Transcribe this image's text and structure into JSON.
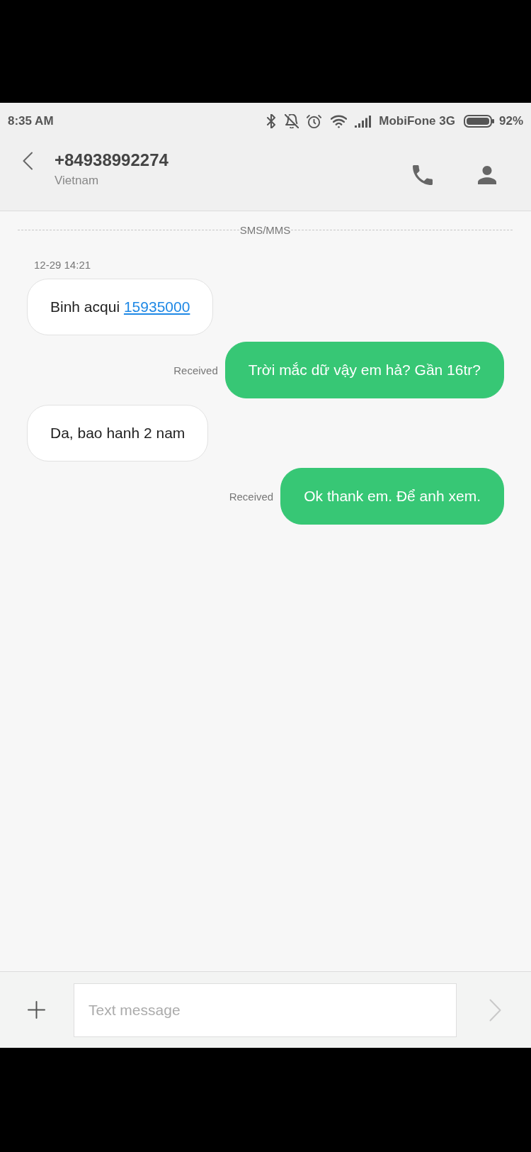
{
  "status_bar": {
    "time": "8:35 AM",
    "carrier": "MobiFone 3G",
    "battery": "92%"
  },
  "header": {
    "title": "+84938992274",
    "subtitle": "Vietnam"
  },
  "thread": {
    "divider": "SMS/MMS",
    "messages": [
      {
        "kind": "timestamp",
        "text": "12-29 14:21"
      },
      {
        "kind": "incoming",
        "text": "Binh acqui",
        "link": "15935000"
      },
      {
        "kind": "outgoing",
        "text": "Trời mắc dữ vậy em hả? Gần 16tr?",
        "status": "Received"
      },
      {
        "kind": "incoming",
        "text": "Da, bao hanh 2 nam"
      },
      {
        "kind": "outgoing",
        "text": "Ok thank em. Để anh xem.",
        "status": "Received"
      }
    ]
  },
  "composer": {
    "placeholder": "Text message",
    "send_disabled": true
  }
}
